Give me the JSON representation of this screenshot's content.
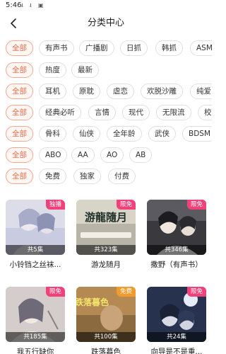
{
  "status_bar": {
    "time": "5:46"
  },
  "header": {
    "title": "分类中心"
  },
  "filters": [
    {
      "row": "genre",
      "items": [
        "全部",
        "有声书",
        "广播剧",
        "日抓",
        "韩抓",
        "ASM"
      ]
    },
    {
      "row": "popularity",
      "items": [
        "全部",
        "热度",
        "最新"
      ]
    },
    {
      "row": "category",
      "items": [
        "全部",
        "耳机",
        "原耽",
        "虐恋",
        "欢脱沙雕",
        "纯爱"
      ]
    },
    {
      "row": "style",
      "items": [
        "全部",
        "经典必听",
        "言情",
        "现代",
        "无限流",
        "校"
      ]
    },
    {
      "row": "theme",
      "items": [
        "全部",
        "骨科",
        "仙侠",
        "全年龄",
        "武侠",
        "BDSM"
      ]
    },
    {
      "row": "audience",
      "items": [
        "全部",
        "ABO",
        "AA",
        "AO",
        "AB"
      ]
    },
    {
      "row": "price",
      "items": [
        "全部",
        "免费",
        "独家",
        "付费"
      ]
    }
  ],
  "works": [
    {
      "badge": "独播",
      "count": "共5集",
      "title": "小铃铛之丝袜..."
    },
    {
      "badge": "限免",
      "count": "共323集",
      "title": "游龙随月",
      "cover_text": "游龍隨月"
    },
    {
      "badge": "限免",
      "count": "共346集",
      "title": "撒野（有声书）"
    },
    {
      "badge": "限免",
      "count": "共185集",
      "title": "我五行缺你"
    },
    {
      "badge": "免费",
      "count": "共100集",
      "title": "跌落暮色",
      "cover_text": "跌落暮色"
    },
    {
      "badge": "限免",
      "count": "共24集",
      "title": "向导是不是重..."
    }
  ],
  "colors": {
    "accent": "#ef6c4a",
    "badge": "#f0417a"
  }
}
